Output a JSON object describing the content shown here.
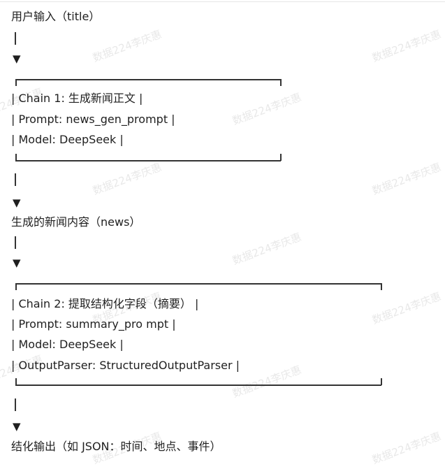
{
  "flow": {
    "input_label": "用户输入（title）",
    "arrow_glyph": "▼",
    "pipe_glyph": "|",
    "chain1": {
      "line1": "| Chain 1: 生成新闻正文 |",
      "line2": "| Prompt: news_gen_prompt |",
      "line3": "| Model: DeepSeek |"
    },
    "mid_label": "生成的新闻内容（news）",
    "chain2": {
      "line1": "| Chain 2: 提取结构化字段（摘要） |",
      "line2": "| Prompt: summary_pro mpt |",
      "line3": "| Model: DeepSeek |",
      "line4": "| OutputParser: StructuredOutputParser |"
    },
    "output_label": "结化输出（如 JSON：时间、地点、事件）"
  },
  "watermark": {
    "text": "数据224李庆惠"
  },
  "colors": {
    "text": "#1f1f1f",
    "box_border": "#333333",
    "watermark": "#969696"
  }
}
